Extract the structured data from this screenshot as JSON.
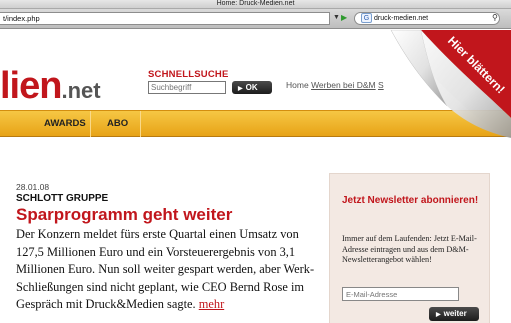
{
  "browser": {
    "window_title": "Home: Druck-Medien.net",
    "url": "t/index.php",
    "search_value": "druck-medien.net",
    "search_engine_badge": "G"
  },
  "site": {
    "logo_main": "lien",
    "logo_suffix": ".net",
    "search": {
      "label": "SCHNELLSUCHE",
      "placeholder": "Suchbegriff",
      "button": "OK"
    },
    "top_links": {
      "home": "Home",
      "werben": "Werben bei D&M",
      "cut": "S"
    },
    "nav": [
      "AWARDS",
      "ABO"
    ],
    "curl_banner": "Hier blättern!"
  },
  "article": {
    "date": "28.01.08",
    "kicker": "SCHLOTT GRUPPE",
    "headline": "Sparprogramm geht weiter",
    "teaser": "Der Konzern meldet fürs erste Quartal einen Umsatz von 127,5 Millionen Euro und ein Vorsteuerergebnis von 3,1 Millionen Euro. Nun soll weiter gespart werden, aber Werk-Schließungen sind nicht geplant, wie CEO Bernd Rose im Gespräch mit Druck&Medien sagte.",
    "more_link": "mehr"
  },
  "newsletter": {
    "title": "Jetzt Newsletter abonnieren!",
    "text": "Immer auf dem Laufenden: Jetzt E-Mail-Adresse eintragen und aus dem D&M-Newsletterangebot wählen!",
    "placeholder": "E-Mail-Adresse",
    "button": "weiter"
  },
  "colors": {
    "brand_red": "#c1161c",
    "nav_yellow": "#f0b62e",
    "newsletter_bg": "#f3e9e3"
  }
}
